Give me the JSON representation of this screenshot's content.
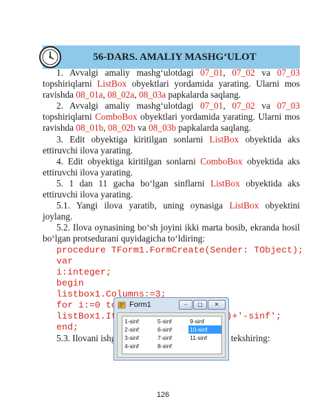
{
  "banner": {
    "title": "56-DARS. AMALIY MASHG‘ULOT"
  },
  "items": {
    "i1": {
      "a": "1. Avvalgi amaliy mashg‘ulotdagi ",
      "t1": "07_01",
      "c1": ", ",
      "t2": "07_02",
      "c2": " va ",
      "t3": "07_03",
      "c3": " topshiriqlarni ",
      "ctrl": "ListBox",
      "c4": " obyektlari yordamida yarating. Ularni mos ravishda ",
      "f1": "08_01a",
      "c5": ", ",
      "f2": "08_02a",
      "c6": ", ",
      "f3": "08_03a",
      "c7": " papkalarda saqlang."
    },
    "i2": {
      "a": "2. Avvalgi amaliy mashg‘ulotdagi ",
      "t1": "07_01",
      "c1": ", ",
      "t2": "07_02",
      "c2": " va ",
      "t3": "07_03",
      "c3": " topshiriqlarni ",
      "ctrl": "ComboBox",
      "c4": " obyektlari yordamida yarating. Ularni mos ravishda ",
      "f1": "08_01b",
      "c5": ", ",
      "f2": "08_02b",
      "c6": " va ",
      "f3": "08_03b",
      "c7": " papkalarda saqlang."
    },
    "i3": {
      "a": "3. Edit obyektiga kiritilgan sonlarni ",
      "ctrl": "ListBox",
      "b": " obyektida aks ettiruvchi ilova yarating."
    },
    "i4": {
      "a": "4. Edit obyektiga kiritilgan sonlarni ",
      "ctrl": "ComboBox",
      "b": " obyektida aks ettiruvchi ilova yarating."
    },
    "i5": {
      "a": "5. 1 dan 11 gacha bo‘lgan  sinflarni ",
      "ctrl": "ListBox",
      "b": " obyektida aks ettiruvchi ilova yarating."
    },
    "i51": {
      "a": "5.1. Yangi ilova yaratib, uning oynasiga ",
      "ctrl": "ListBox",
      "b": " obyektini joylang."
    },
    "i52": {
      "a": "5.2. Ilova oynasining bo‘sh joyini ikki marta bosib, ekranda hosil bo‘lgan protsedurani quyidagicha to‘ldiring:"
    },
    "i53": {
      "a": "5.3. Ilovani ishga tushiring va to‘g‘ri ishlashini tekshiring:"
    }
  },
  "code": [
    "procedure TForm1.FormCreate(Sender: TObject);",
    "var",
    "i:integer;",
    "begin",
    "listbox1.Columns:=3;",
    "for i:=0 to 10 do",
    "listBox1.Items[i]:=inttostr(i+1)+'-sinf';",
    "end;"
  ],
  "window": {
    "title": "Form1",
    "buttons": {
      "minimize": "–",
      "maximize": "□",
      "close": "✕"
    },
    "listbox": {
      "columns": [
        [
          "1-sinf",
          "2-sinf",
          "3-sinf",
          "4-sinf"
        ],
        [
          "5-sinf",
          "6-sinf",
          "7-sinf",
          "8-sinf"
        ],
        [
          "9-sinf",
          "10-sinf",
          "11-sinf"
        ]
      ],
      "selected": "10-sinf"
    }
  },
  "page_number": "126",
  "colors": {
    "accent": "#d4231c",
    "banner": "#8ec9ea",
    "selection": "#3399ff"
  },
  "icons": [
    "lesson-clock-badge-icon",
    "delphi-app-icon"
  ]
}
